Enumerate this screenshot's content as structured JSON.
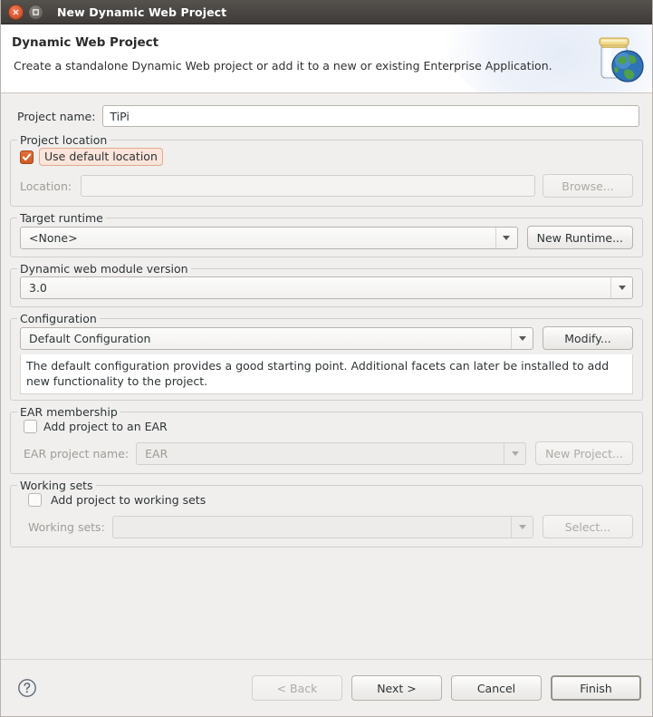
{
  "window": {
    "title": "New Dynamic Web Project",
    "close_icon": "close-icon",
    "maximize_icon": "maximize-icon"
  },
  "banner": {
    "title": "Dynamic Web Project",
    "subtitle": "Create a standalone Dynamic Web project or add it to a new or existing Enterprise Application.",
    "icon": "web-project-jar-globe-icon"
  },
  "project_name": {
    "label": "Project name:",
    "value": "TiPi",
    "placeholder": ""
  },
  "project_location": {
    "group_label": "Project location",
    "use_default_label": "Use default location",
    "use_default_checked": true,
    "location_label": "Location:",
    "location_value": "",
    "browse_label": "Browse..."
  },
  "target_runtime": {
    "group_label": "Target runtime",
    "selected": "<None>",
    "new_runtime_label": "New Runtime..."
  },
  "module_version": {
    "group_label": "Dynamic web module version",
    "selected": "3.0"
  },
  "configuration": {
    "group_label": "Configuration",
    "selected": "Default Configuration",
    "modify_label": "Modify...",
    "description": "The default configuration provides a good starting point. Additional facets can later be installed to add new functionality to the project."
  },
  "ear_membership": {
    "group_label": "EAR membership",
    "add_to_ear_label": "Add project to an EAR",
    "add_to_ear_checked": false,
    "ear_project_name_label": "EAR project name:",
    "ear_project_name_value": "EAR",
    "new_project_label": "New Project..."
  },
  "working_sets": {
    "group_label": "Working sets",
    "add_to_working_sets_label": "Add project to working sets",
    "add_to_working_sets_checked": false,
    "working_sets_label": "Working sets:",
    "working_sets_value": "",
    "select_label": "Select..."
  },
  "footer": {
    "help_icon": "help-icon",
    "back_label": "< Back",
    "next_label": "Next >",
    "cancel_label": "Cancel",
    "finish_label": "Finish"
  },
  "colors": {
    "accent": "#cf5a22",
    "focus_ring": "#e3a98f",
    "focus_bg": "#fbe4da",
    "titlebar": "#4a4643",
    "dialog_bg": "#f0efee"
  }
}
